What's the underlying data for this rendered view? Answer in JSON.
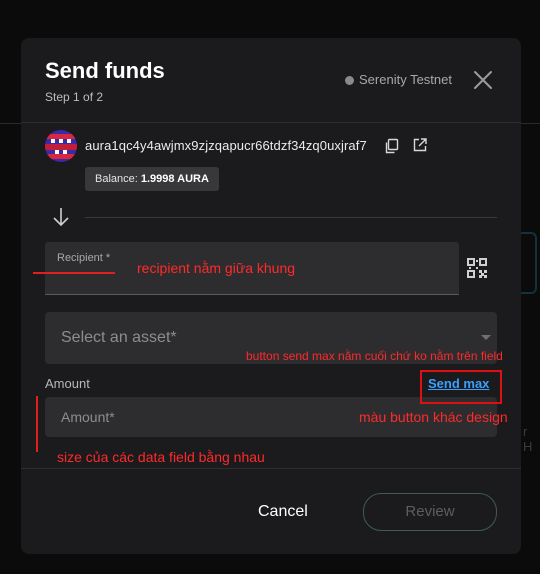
{
  "modal": {
    "title": "Send funds",
    "step": "Step 1 of 2",
    "network": "Serenity Testnet",
    "close_icon": "close-icon"
  },
  "account": {
    "address": "aura1qc4y4awjmx9zjzqapucr66tdzf34zq0uxjraf7",
    "balance_prefix": "Balance: ",
    "balance_value": "1.9998 AURA",
    "copy_icon": "copy-icon",
    "external_icon": "external-link-icon"
  },
  "form": {
    "recipient_label": "Recipient *",
    "asset_placeholder": "Select an asset*",
    "amount_label": "Amount",
    "send_max": "Send max",
    "amount_placeholder": "Amount*",
    "qr_icon": "qr-code-icon"
  },
  "footer": {
    "cancel": "Cancel",
    "review": "Review"
  },
  "annotations": {
    "recipient_note": "recipient nằm giữa khung",
    "send_max_note": "button send max nằm cuối chứ ko nằm trên field",
    "color_note": "màu button khác design",
    "size_note": "size của các data field bằng nhau"
  },
  "background": {
    "text_fragment": "r H"
  },
  "colors": {
    "modal_bg": "#1b1b1d",
    "field_bg": "#2d2d30",
    "link": "#3aa0ff",
    "annotation": "#ff2a2a",
    "review_border": "#3d5d4f"
  }
}
